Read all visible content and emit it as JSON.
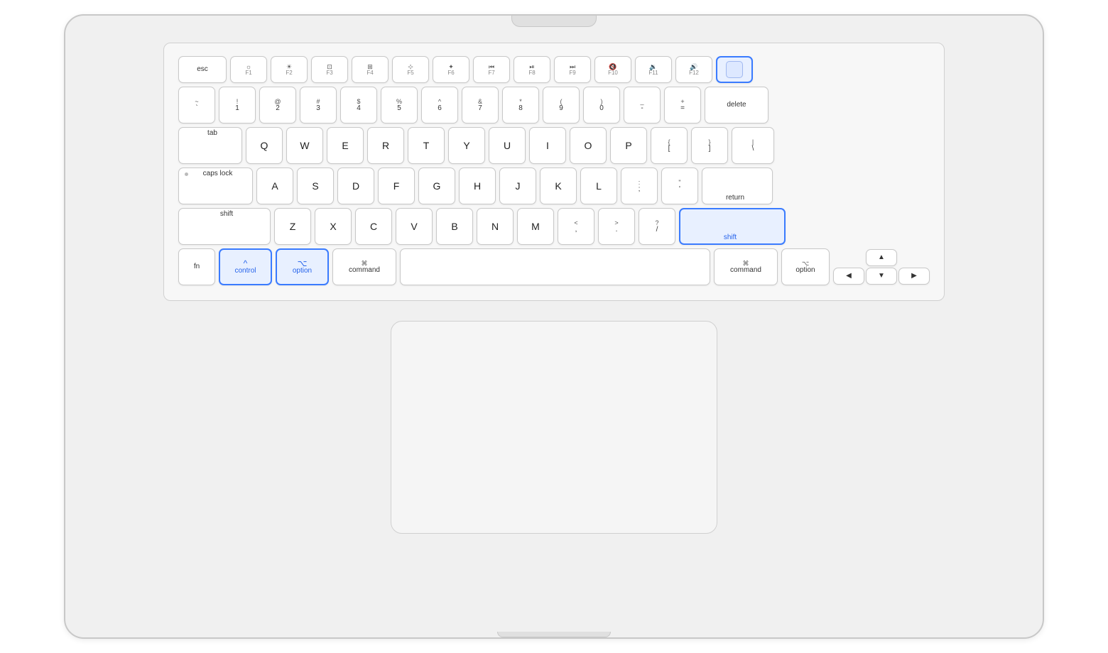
{
  "keyboard": {
    "rows": {
      "function_row": [
        {
          "id": "esc",
          "label": "esc",
          "size": "esc"
        },
        {
          "id": "f1",
          "top": "☼",
          "bottom": "F1",
          "size": "fn"
        },
        {
          "id": "f2",
          "top": "☀",
          "bottom": "F2",
          "size": "fn"
        },
        {
          "id": "f3",
          "top": "⊞",
          "bottom": "F3",
          "size": "fn"
        },
        {
          "id": "f4",
          "top": "⊞⊞",
          "bottom": "F4",
          "size": "fn"
        },
        {
          "id": "f5",
          "top": "·",
          "bottom": "F5",
          "size": "fn"
        },
        {
          "id": "f6",
          "top": "·↑",
          "bottom": "F6",
          "size": "fn"
        },
        {
          "id": "f7",
          "top": "⏪",
          "bottom": "F7",
          "size": "fn"
        },
        {
          "id": "f8",
          "top": "⏯",
          "bottom": "F8",
          "size": "fn"
        },
        {
          "id": "f9",
          "top": "⏩",
          "bottom": "F9",
          "size": "fn"
        },
        {
          "id": "f10",
          "top": "🔇",
          "bottom": "F10",
          "size": "fn"
        },
        {
          "id": "f11",
          "top": "🔉",
          "bottom": "F11",
          "size": "fn"
        },
        {
          "id": "f12",
          "top": "🔊",
          "bottom": "F12",
          "size": "fn"
        },
        {
          "id": "power",
          "label": "",
          "size": "power",
          "highlighted": true
        }
      ],
      "number_row": [
        {
          "id": "tilde",
          "top": "~",
          "bottom": "`"
        },
        {
          "id": "1",
          "top": "!",
          "bottom": "1"
        },
        {
          "id": "2",
          "top": "@",
          "bottom": "2"
        },
        {
          "id": "3",
          "top": "#",
          "bottom": "3"
        },
        {
          "id": "4",
          "top": "$",
          "bottom": "4"
        },
        {
          "id": "5",
          "top": "%",
          "bottom": "5"
        },
        {
          "id": "6",
          "top": "^",
          "bottom": "6"
        },
        {
          "id": "7",
          "top": "&",
          "bottom": "7"
        },
        {
          "id": "8",
          "top": "*",
          "bottom": "8"
        },
        {
          "id": "9",
          "top": "(",
          "bottom": "9"
        },
        {
          "id": "0",
          "top": ")",
          "bottom": "0"
        },
        {
          "id": "minus",
          "top": "_",
          "bottom": "-"
        },
        {
          "id": "equals",
          "top": "+",
          "bottom": "="
        },
        {
          "id": "delete",
          "label": "delete",
          "size": "delete"
        }
      ],
      "qwerty_row": [
        {
          "id": "tab",
          "label": "tab",
          "size": "tab"
        },
        {
          "id": "q",
          "label": "Q"
        },
        {
          "id": "w",
          "label": "W"
        },
        {
          "id": "e",
          "label": "E"
        },
        {
          "id": "r",
          "label": "R"
        },
        {
          "id": "t",
          "label": "T"
        },
        {
          "id": "y",
          "label": "Y"
        },
        {
          "id": "u",
          "label": "U"
        },
        {
          "id": "i",
          "label": "I"
        },
        {
          "id": "o",
          "label": "O"
        },
        {
          "id": "p",
          "label": "P"
        },
        {
          "id": "lbracket",
          "top": "{",
          "bottom": "["
        },
        {
          "id": "rbracket",
          "top": "}",
          "bottom": "]"
        },
        {
          "id": "backslash",
          "top": "|",
          "bottom": "\\"
        }
      ],
      "asdf_row": [
        {
          "id": "caps",
          "label": "caps lock",
          "size": "caps",
          "has_dot": true
        },
        {
          "id": "a",
          "label": "A"
        },
        {
          "id": "s",
          "label": "S"
        },
        {
          "id": "d",
          "label": "D"
        },
        {
          "id": "f",
          "label": "F"
        },
        {
          "id": "g",
          "label": "G"
        },
        {
          "id": "h",
          "label": "H"
        },
        {
          "id": "j",
          "label": "J"
        },
        {
          "id": "k",
          "label": "K"
        },
        {
          "id": "l",
          "label": "L"
        },
        {
          "id": "semicolon",
          "top": ":",
          "bottom": ";"
        },
        {
          "id": "quote",
          "top": "\"",
          "bottom": "'"
        },
        {
          "id": "return",
          "label": "return",
          "size": "return"
        }
      ],
      "zxcv_row": [
        {
          "id": "shift_left",
          "label": "shift",
          "size": "shift-left"
        },
        {
          "id": "z",
          "label": "Z"
        },
        {
          "id": "x",
          "label": "X"
        },
        {
          "id": "c",
          "label": "C"
        },
        {
          "id": "v",
          "label": "V"
        },
        {
          "id": "b",
          "label": "B"
        },
        {
          "id": "n",
          "label": "N"
        },
        {
          "id": "m",
          "label": "M"
        },
        {
          "id": "comma",
          "top": "<",
          "bottom": ","
        },
        {
          "id": "period",
          "top": ">",
          "bottom": "."
        },
        {
          "id": "slash",
          "top": "?",
          "bottom": "/"
        },
        {
          "id": "shift_right",
          "label": "shift",
          "size": "shift-right",
          "highlighted": true
        }
      ],
      "bottom_row": [
        {
          "id": "fn",
          "label": "fn",
          "size": "fn-key"
        },
        {
          "id": "control",
          "top": "^",
          "bottom": "control",
          "size": "control",
          "highlighted": true
        },
        {
          "id": "option_left",
          "top": "⌥",
          "bottom": "option",
          "size": "option",
          "highlighted": true
        },
        {
          "id": "command_left",
          "top": "⌘",
          "bottom": "command",
          "size": "command-left"
        },
        {
          "id": "space",
          "label": "",
          "size": "space"
        },
        {
          "id": "command_right",
          "top": "⌘",
          "bottom": "command",
          "size": "command-right"
        },
        {
          "id": "option_right",
          "top": "⌥",
          "bottom": "option",
          "size": "option-right"
        }
      ]
    }
  }
}
